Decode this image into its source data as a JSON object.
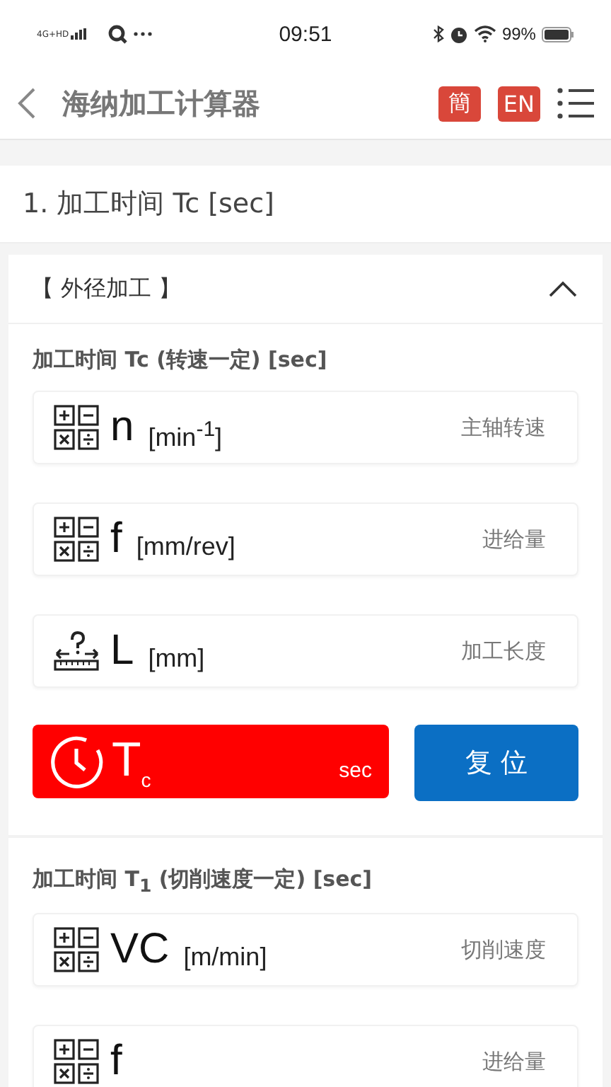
{
  "status_bar": {
    "network": "4G+HD",
    "time": "09:51",
    "battery": "99%"
  },
  "header": {
    "title": "海纳加工计算器",
    "languages": [
      {
        "label": "簡"
      },
      {
        "label": "EN"
      }
    ]
  },
  "section": {
    "title": "1. 加工时间 Tc [sec]"
  },
  "panel": {
    "title": "【 外径加工 】",
    "expanded": true,
    "groups": [
      {
        "title": "加工时间 Tc (转速一定) [sec]",
        "inputs": [
          {
            "kind": "calc",
            "symbol": "n",
            "unit": "[min$^{-1}$]",
            "placeholder": "主轴转速"
          },
          {
            "kind": "calc",
            "symbol": "f",
            "unit": "[mm/rev]",
            "placeholder": "进给量"
          },
          {
            "kind": "length",
            "symbol": "L",
            "unit": "[mm]",
            "placeholder": "加工长度"
          }
        ],
        "result": {
          "symbol": "T$_{c}$",
          "unit": "sec"
        },
        "reset": "复 位"
      },
      {
        "title": "加工时间 T$_{1}$ (切削速度一定) [sec]",
        "inputs": [
          {
            "kind": "calc",
            "symbol": "VC",
            "unit": "[m/min]",
            "placeholder": "切削速度"
          },
          {
            "kind": "calc",
            "symbol": "f",
            "placeholder": "进给量"
          }
        ]
      }
    ]
  }
}
